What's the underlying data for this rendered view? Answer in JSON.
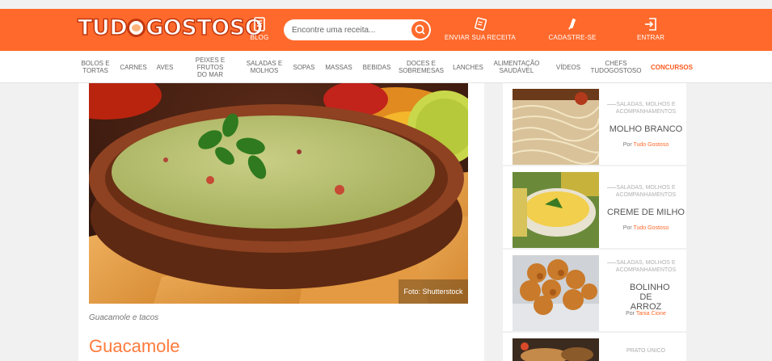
{
  "header": {
    "logo_text": "TUDOGOSTOSO",
    "blog_label": "BLOG",
    "search_placeholder": "Encontre uma receita...",
    "send_recipe_label": "ENVIAR SUA RECEITA",
    "register_label": "CADASTRE-SE",
    "login_label": "ENTRAR",
    "brand_color": "#ff6a2c"
  },
  "categories": [
    {
      "line1": "BOLOS E",
      "line2": "TORTAS"
    },
    {
      "line1": "CARNES",
      "line2": ""
    },
    {
      "line1": "AVES",
      "line2": ""
    },
    {
      "line1": "PEIXES E FRUTOS",
      "line2": "DO MAR"
    },
    {
      "line1": "SALADAS E",
      "line2": "MOLHOS"
    },
    {
      "line1": "SOPAS",
      "line2": ""
    },
    {
      "line1": "MASSAS",
      "line2": ""
    },
    {
      "line1": "BEBIDAS",
      "line2": ""
    },
    {
      "line1": "DOCES E",
      "line2": "SOBREMESAS"
    },
    {
      "line1": "LANCHES",
      "line2": ""
    },
    {
      "line1": "ALIMENTAÇÃO",
      "line2": "SAUDÁVEL"
    },
    {
      "line1": "VÍDEOS",
      "line2": ""
    },
    {
      "line1": "CHEFS",
      "line2": "TUDOGOSTOSO"
    },
    {
      "line1": "CONCURSOS",
      "line2": ""
    }
  ],
  "main": {
    "photo_credit": "Foto: Shutterstock",
    "caption": "Guacamole e tacos",
    "title": "Guacamole"
  },
  "sidebar": {
    "by_label": "Por",
    "cards": [
      {
        "category": "SALADAS, MOLHOS E ACOMPANHAMENTOS",
        "title": "MOLHO BRANCO",
        "author": "Tudo Gostoso"
      },
      {
        "category": "SALADAS, MOLHOS E ACOMPANHAMENTOS",
        "title": "CREME DE MILHO",
        "author": "Tudo Gostoso"
      },
      {
        "category": "SALADAS, MOLHOS E ACOMPANHAMENTOS",
        "title": "BOLINHO DE ARROZ",
        "author": "Tania Cione"
      },
      {
        "category": "PRATO ÚNICO"
      }
    ]
  }
}
